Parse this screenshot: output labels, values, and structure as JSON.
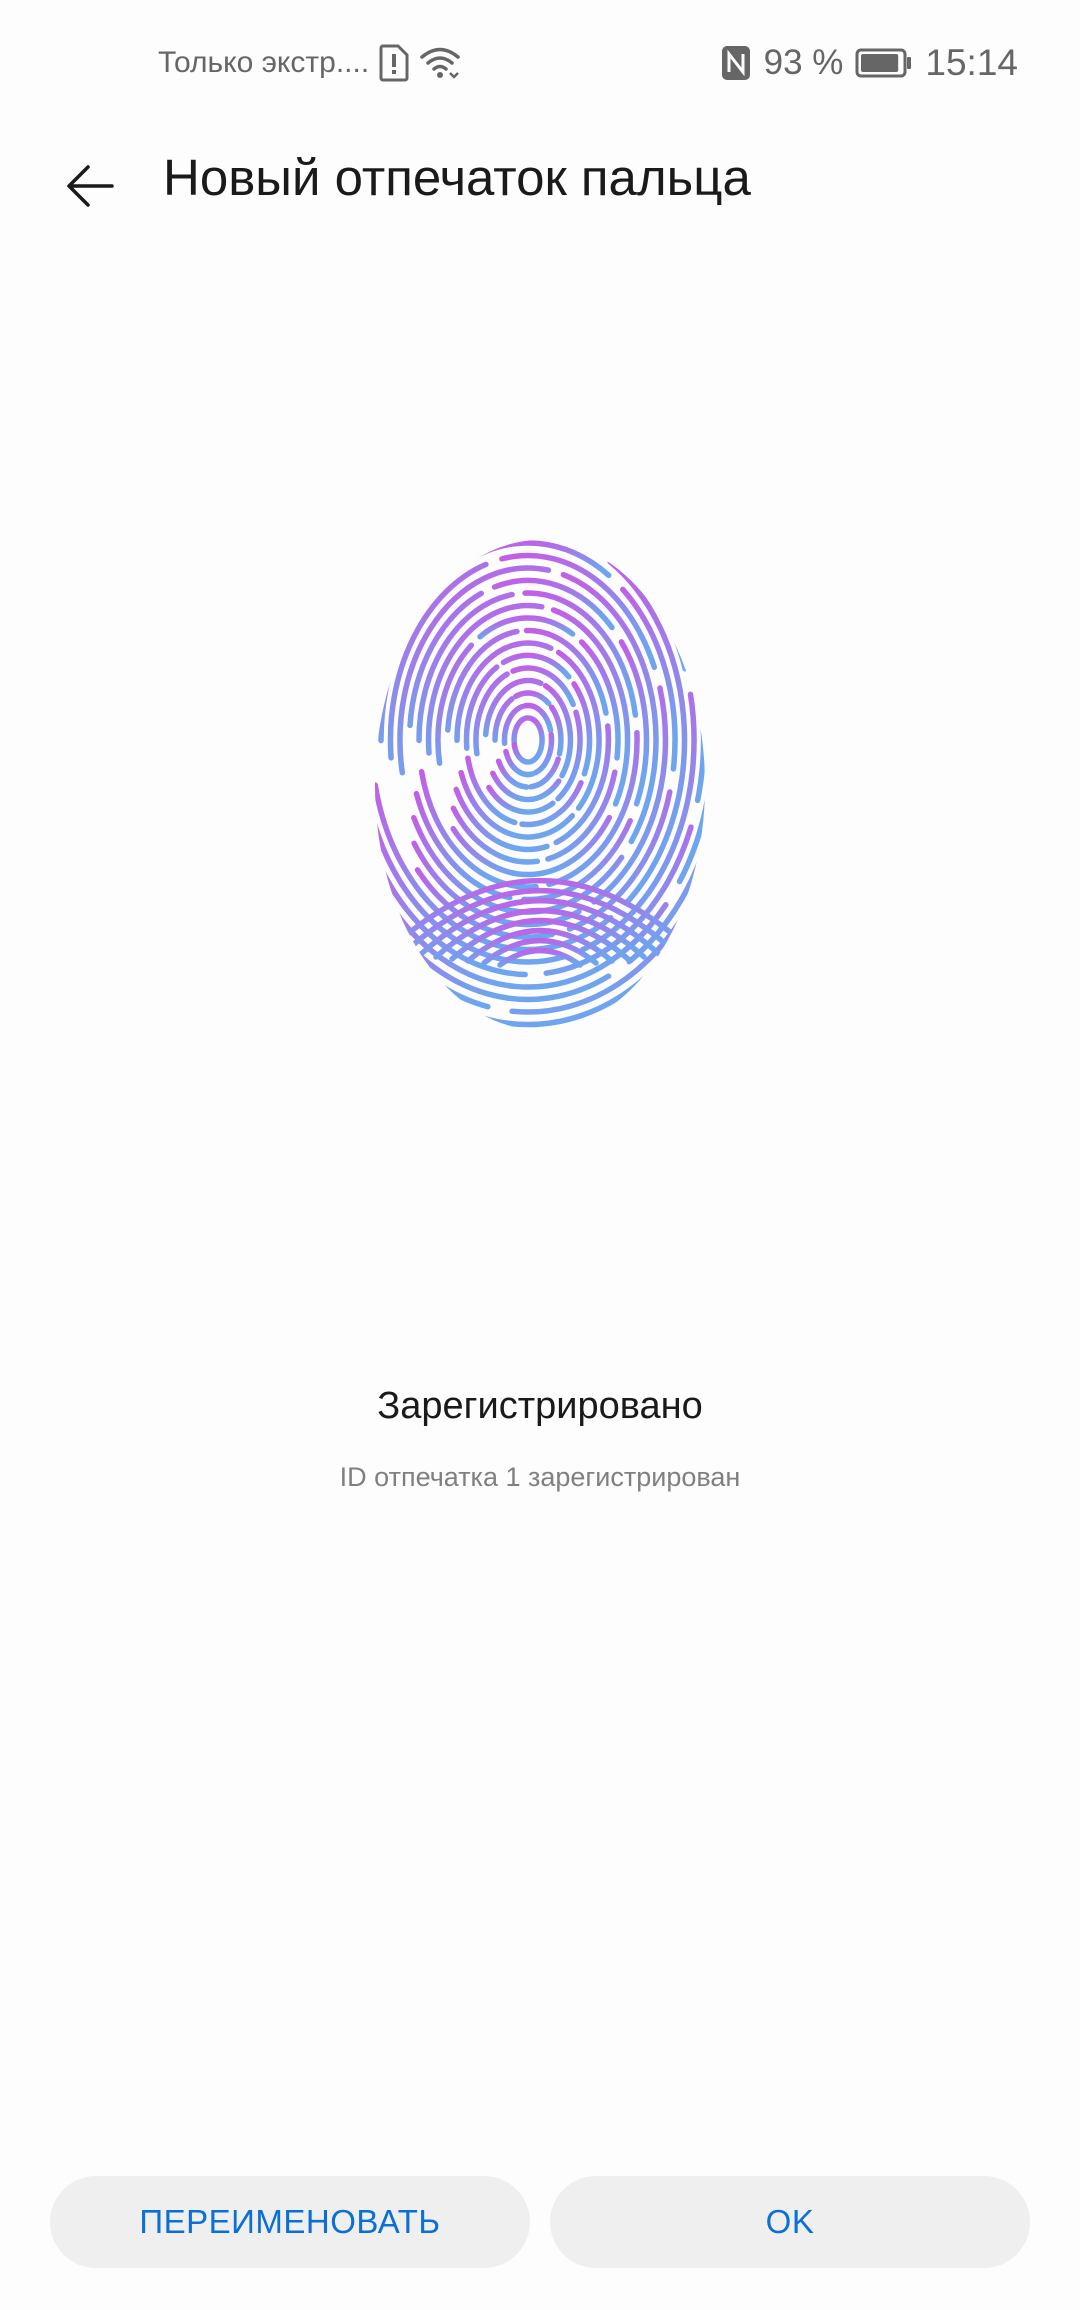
{
  "status_bar": {
    "carrier_text": "Только экстр....",
    "sim_alert_icon": "sim-alert-icon",
    "wifi_icon": "wifi-icon",
    "nfc_icon": "nfc-icon",
    "battery_percent": "93 %",
    "battery_level": 0.93,
    "time": "15:14"
  },
  "app_bar": {
    "back_icon": "arrow-left-icon",
    "title": "Новый отпечаток пальца"
  },
  "fingerprint": {
    "icon": "fingerprint-icon",
    "gradient_top": "#c35ee6",
    "gradient_bottom": "#6fa4ef"
  },
  "result": {
    "title": "Зарегистрировано",
    "subtitle": "ID отпечатка 1 зарегистрирован"
  },
  "buttons": {
    "rename_label": "ПЕРЕИМЕНОВАТЬ",
    "ok_label": "OK",
    "accent_color": "#0a6fd6"
  }
}
